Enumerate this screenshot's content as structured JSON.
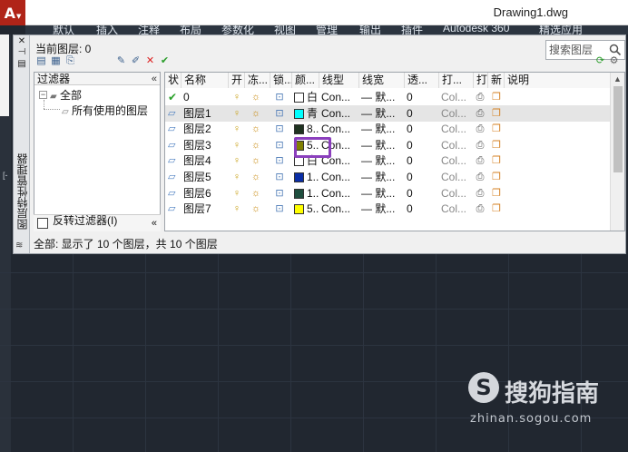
{
  "app": {
    "app_button": "A",
    "document_title": "Drawing1.dwg"
  },
  "ribbon": {
    "tabs": [
      "默认",
      "插入",
      "注释",
      "布局",
      "参数化",
      "视图",
      "管理",
      "输出",
      "插件",
      "Autodesk 360",
      "精选应用"
    ]
  },
  "palette": {
    "vertical_title": "图层特性管理器",
    "current_layer_label": "当前图层: 0",
    "search_placeholder": "搜索图层",
    "side_controls": [
      "✕",
      "⊣",
      "▤"
    ],
    "tree": {
      "header": "过滤器",
      "collapse": "«",
      "root": "全部",
      "child": "所有使用的图层",
      "invert_label": "反转过滤器(I)",
      "invert_checked": false
    },
    "columns": [
      "状",
      "名称",
      "开",
      "冻...",
      "锁...",
      "颜...",
      "线型",
      "线宽",
      "透...",
      "打...",
      "打",
      "新",
      "说明"
    ],
    "layers": [
      {
        "status": "current",
        "name": "0",
        "color_hex": "#ffffff",
        "color_name": "白",
        "linetype": "Con...",
        "lineweight": "— 默...",
        "transparency": "0",
        "plot_style": "Col...",
        "selected": false
      },
      {
        "status": "layer",
        "name": "图层1",
        "color_hex": "#00ffff",
        "color_name": "青",
        "linetype": "Con...",
        "lineweight": "— 默...",
        "transparency": "0",
        "plot_style": "Col...",
        "selected": true
      },
      {
        "status": "layer",
        "name": "图层2",
        "color_hex": "#1f3320",
        "color_name": "8...",
        "linetype": "Con...",
        "lineweight": "— 默...",
        "transparency": "0",
        "plot_style": "Col...",
        "selected": false
      },
      {
        "status": "layer",
        "name": "图层3",
        "color_hex": "#808000",
        "color_name": "5...",
        "linetype": "Con...",
        "lineweight": "— 默...",
        "transparency": "0",
        "plot_style": "Col...",
        "selected": false
      },
      {
        "status": "layer",
        "name": "图层4",
        "color_hex": "#ffffff",
        "color_name": "白",
        "linetype": "Con...",
        "lineweight": "— 默...",
        "transparency": "0",
        "plot_style": "Col...",
        "selected": false
      },
      {
        "status": "layer",
        "name": "图层5",
        "color_hex": "#0a2ea6",
        "color_name": "1...",
        "linetype": "Con...",
        "lineweight": "— 默...",
        "transparency": "0",
        "plot_style": "Col...",
        "selected": false
      },
      {
        "status": "layer",
        "name": "图层6",
        "color_hex": "#1f4f3f",
        "color_name": "1...",
        "linetype": "Con...",
        "lineweight": "— 默...",
        "transparency": "0",
        "plot_style": "Col...",
        "selected": false
      },
      {
        "status": "layer",
        "name": "图层7",
        "color_hex": "#ffff00",
        "color_name": "5...",
        "linetype": "Con...",
        "lineweight": "— 默...",
        "transparency": "0",
        "plot_style": "Col...",
        "selected": false
      }
    ],
    "status_text": "全部: 显示了 10 个图层，共 10 个图层"
  },
  "watermark": {
    "logo_letter": "S",
    "brand": "搜狗指南",
    "url": "zhinan.sogou.com"
  },
  "colors": {
    "highlight": "#8b3fbd",
    "canvas": "#212730",
    "app_red": "#b02418"
  }
}
